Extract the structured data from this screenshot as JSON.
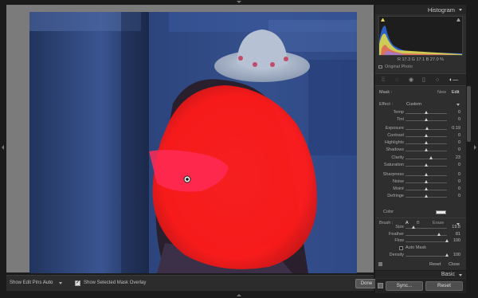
{
  "toolbar": {
    "edit_pins_label": "Show Edit Pins :",
    "edit_pins_value": "Auto",
    "overlay_label": "Show Selected Mask Overlay",
    "overlay_checked": true,
    "done_label": "Done"
  },
  "histogram": {
    "title": "Histogram",
    "readout": "R  17.3  G  17.1  B  27.0  %",
    "original_photo_label": "Original Photo"
  },
  "tools": [
    "crop-grid-icon",
    "spot-removal-icon",
    "red-eye-icon",
    "graduated-filter-icon",
    "radial-filter-icon",
    "adjustment-brush-icon"
  ],
  "mask": {
    "label": "Mask :",
    "new_label": "New",
    "edit_label": "Edit"
  },
  "effect": {
    "label": "Effect :",
    "value": "Custom"
  },
  "sliders": [
    {
      "label": "Temp",
      "value": "0",
      "pos": 0.5
    },
    {
      "label": "Tint",
      "value": "0",
      "pos": 0.5
    },
    {
      "label": "Exposure",
      "value": "0.19",
      "pos": 0.52
    },
    {
      "label": "Contrast",
      "value": "0",
      "pos": 0.5
    },
    {
      "label": "Highlights",
      "value": "0",
      "pos": 0.5
    },
    {
      "label": "Shadows",
      "value": "0",
      "pos": 0.5
    },
    {
      "label": "Clarity",
      "value": "23",
      "pos": 0.61
    },
    {
      "label": "Saturation",
      "value": "0",
      "pos": 0.5
    },
    {
      "label": "Sharpness",
      "value": "0",
      "pos": 0.5
    },
    {
      "label": "Noise",
      "value": "0",
      "pos": 0.5
    },
    {
      "label": "Moiré",
      "value": "0",
      "pos": 0.5
    },
    {
      "label": "Defringe",
      "value": "0",
      "pos": 0.5
    }
  ],
  "color_label": "Color",
  "brush": {
    "label": "Brush :",
    "a_label": "A",
    "b_label": "B",
    "erase_label": "Erase",
    "sliders": [
      {
        "label": "Size",
        "value": "19.8",
        "pos": 0.2
      },
      {
        "label": "Feather",
        "value": "81",
        "pos": 0.81
      },
      {
        "label": "Flow",
        "value": "100",
        "pos": 1.0
      }
    ],
    "auto_mask_label": "Auto Mask",
    "density": {
      "label": "Density",
      "value": "100",
      "pos": 1.0
    }
  },
  "footer": {
    "reset_label": "Reset",
    "close_label": "Close"
  },
  "basic_title": "Basic",
  "sync_label": "Sync...",
  "reset_button_label": "Reset",
  "colors": {
    "mask_overlay": "#ff1a1a",
    "panel_bg": "#2e2e2e",
    "photo_bg": "#22304f"
  }
}
